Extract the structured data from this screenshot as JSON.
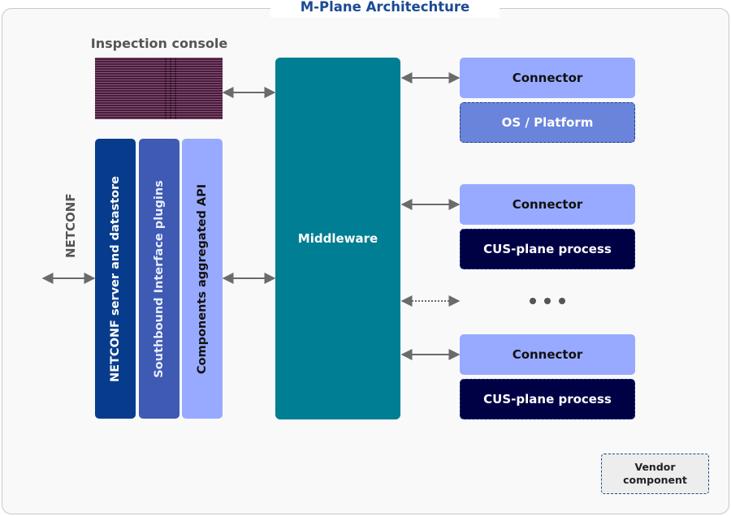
{
  "diagram": {
    "title": "M-Plane Architechture",
    "inspection_console": {
      "label": "Inspection console"
    },
    "netconf_interface": {
      "label": "NETCONF"
    },
    "stack": [
      {
        "label": "NETCONF server and datastore",
        "color": "#073c8c"
      },
      {
        "label": "Southbound Interface plugins",
        "color": "#3e5ab2"
      },
      {
        "label": "Components aggregated  API",
        "color": "#98aaff"
      }
    ],
    "middleware": {
      "label": "Middleware",
      "color": "#007e93"
    },
    "components": [
      {
        "connector": "Connector",
        "process": "OS / Platform",
        "process_color": "#6a84dc"
      },
      {
        "connector": "Connector",
        "process": "CUS-plane process",
        "process_color": "#000045"
      },
      {
        "connector": "Connector",
        "process": "CUS-plane process",
        "process_color": "#000045"
      }
    ],
    "ellipsis": "...",
    "legend": {
      "line1": "Vendor",
      "line2": "component"
    }
  }
}
